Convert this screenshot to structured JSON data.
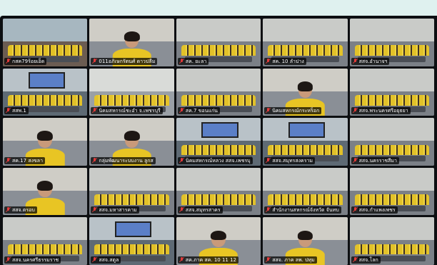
{
  "app": {
    "name": "video-conference-gallery"
  },
  "colors": {
    "muted_mic": "#e23b3b",
    "label_bg": "#000000",
    "shirt_yellow": "#e8c524",
    "background": "#dff1ef"
  },
  "tiles": [
    {
      "label": "กสค79ร้อยเอ็ด",
      "scene": "room",
      "muted": true
    },
    {
      "label": "011อภิเษกรัตนศ์ ดาวปลืม",
      "scene": "person",
      "muted": true
    },
    {
      "label": "สค. ยะลา",
      "scene": "crowd",
      "muted": true
    },
    {
      "label": "สค. 10 ลำปาง",
      "scene": "crowd",
      "muted": true
    },
    {
      "label": "สสจ.อำนาจฯ",
      "scene": "crowd",
      "muted": true
    },
    {
      "label": "สสพ.1",
      "scene": "meeting",
      "muted": true
    },
    {
      "label": "นิคมสหกรณ์ชะอำ จ.เพชรบุรี",
      "scene": "office",
      "muted": true
    },
    {
      "label": "สค.7 ขอนแก่น",
      "scene": "crowd",
      "muted": true
    },
    {
      "label": "นิคมสหกรณ์กระหร็อก",
      "scene": "person",
      "muted": true
    },
    {
      "label": "สสจ.พระนครศรีอยุธยา",
      "scene": "crowd",
      "muted": true
    },
    {
      "label": "สค.17 สงขลา",
      "scene": "person",
      "muted": true
    },
    {
      "label": "กลุ่มพัฒนาระบบงาน ลูกส",
      "scene": "person",
      "muted": true
    },
    {
      "label": "นิคมสหกรณ์หลวง สสจ.เพชรบุ",
      "scene": "meeting",
      "muted": true
    },
    {
      "label": "สสจ.สมุทรสงคราม",
      "scene": "meeting",
      "muted": true
    },
    {
      "label": "สสจ.นครราชสีมา",
      "scene": "crowd",
      "muted": true
    },
    {
      "label": "สสจ.ตรอบ",
      "scene": "person",
      "muted": true
    },
    {
      "label": "สสจ.มหาสารคาม",
      "scene": "crowd",
      "muted": true
    },
    {
      "label": "สสจ.สมุทรสาคร",
      "scene": "crowd",
      "muted": true
    },
    {
      "label": "สำนักงานสหกรณ์จังหวัด จันทบ",
      "scene": "crowd",
      "muted": true
    },
    {
      "label": "สสจ.กำแพงเพชร",
      "scene": "crowd",
      "muted": true
    },
    {
      "label": "สสจ.นครศรีธรรมราช",
      "scene": "crowd",
      "muted": true
    },
    {
      "label": "สสจ.สตูล",
      "scene": "meeting",
      "muted": true
    },
    {
      "label": "สค.ภาค สค. 10 11 12",
      "scene": "person",
      "muted": true
    },
    {
      "label": "สสจ. ภาค ลพ. ปทุม",
      "scene": "person",
      "muted": true
    },
    {
      "label": "สสจ.โลก",
      "scene": "crowd",
      "muted": true
    }
  ]
}
